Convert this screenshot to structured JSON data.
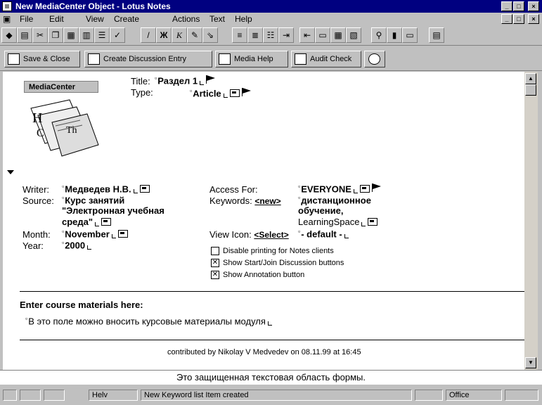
{
  "window": {
    "title": "New MediaCenter Object - Lotus Notes"
  },
  "menu": [
    "File",
    "Edit",
    "View",
    "Create",
    "Actions",
    "Text",
    "Help"
  ],
  "toolbar": {
    "bold": "Ж",
    "italic": "К"
  },
  "actions": [
    {
      "label": "Save & Close",
      "icon": "save-icon"
    },
    {
      "label": "Create Discussion Entry",
      "icon": "discussion-icon"
    },
    {
      "label": "Media Help",
      "icon": "help-icon"
    },
    {
      "label": "Audit Check",
      "icon": "check-icon"
    },
    {
      "label": "",
      "icon": "eye-icon"
    }
  ],
  "header": {
    "badge": "MediaCenter",
    "title_label": "Title:",
    "title_value": "Раздел 1",
    "type_label": "Type:",
    "type_value": "Article"
  },
  "fields": {
    "writer_label": "Writer:",
    "writer_value": "Медведев Н.В.",
    "source_label": "Source:",
    "source_lines": [
      "Курс занятий",
      "\"Электронная учебная",
      "среда\""
    ],
    "month_label": "Month:",
    "month_value": "November",
    "year_label": "Year:",
    "year_value": "2000",
    "access_label": "Access For:",
    "access_value": "EVERYONE",
    "keywords_label": "Keywords:",
    "keywords_link": "<new>",
    "keywords_lines": [
      "дистанционное",
      "обучение,",
      "LearningSpace"
    ],
    "viewicon_label": "View Icon:",
    "viewicon_link": "<Select>",
    "viewicon_value": "- default -"
  },
  "checkboxes": [
    {
      "label": "Disable printing for Notes clients",
      "checked": false
    },
    {
      "label": "Show Start/Join Discussion buttons",
      "checked": true
    },
    {
      "label": "Show Annotation button",
      "checked": true
    }
  ],
  "course": {
    "heading": "Enter course materials here:",
    "text": "В это поле можно вносить курсовые материалы модуля"
  },
  "footer": {
    "contributed": "contributed by Nikolay V Medvedev on 08.11.99 at 16:45"
  },
  "status_message": "Это защищенная текстовая область формы.",
  "statusbar": {
    "font": "Helv",
    "message": "New Keyword list Item created",
    "location": "Office"
  }
}
